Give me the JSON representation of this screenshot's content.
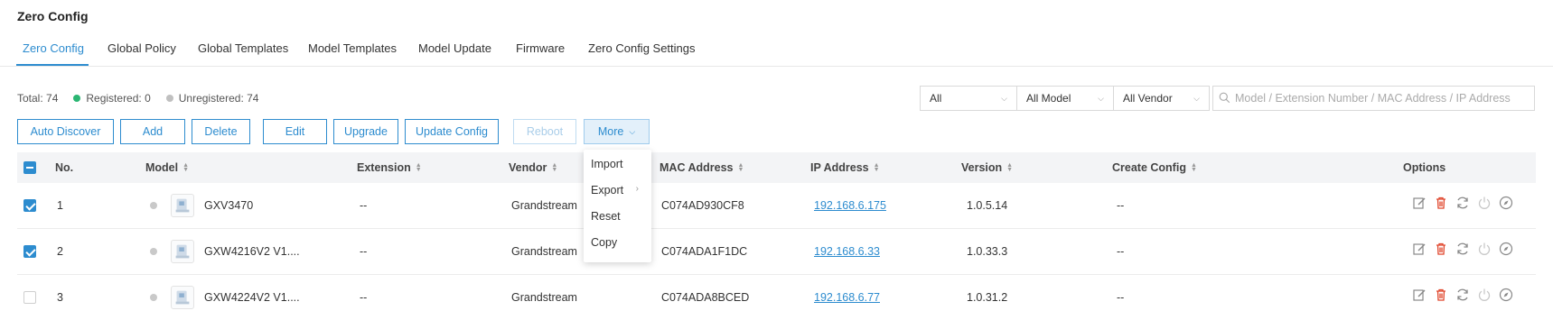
{
  "page": {
    "title": "Zero Config"
  },
  "tabs": [
    {
      "label": "Zero Config",
      "active": true
    },
    {
      "label": "Global Policy"
    },
    {
      "label": "Global Templates"
    },
    {
      "label": "Model Templates"
    },
    {
      "label": "Model Update"
    },
    {
      "label": "Firmware"
    },
    {
      "label": "Zero Config Settings"
    }
  ],
  "summary": {
    "total": "Total: 74",
    "registered": "Registered: 0",
    "unregistered": "Unregistered: 74",
    "registered_color": "#2bb673",
    "unregistered_color": "#c0c0c0"
  },
  "filters": {
    "status": "All",
    "model": "All Model",
    "vendor": "All Vendor",
    "search_placeholder": "Model / Extension Number / MAC Address / IP Address"
  },
  "toolbar": {
    "auto_discover": "Auto Discover",
    "add": "Add",
    "delete": "Delete",
    "edit": "Edit",
    "upgrade": "Upgrade",
    "update_config": "Update Config",
    "reboot": "Reboot",
    "more": "More"
  },
  "more_menu": {
    "items": [
      "Import",
      "Export",
      "Reset",
      "Copy"
    ]
  },
  "table": {
    "columns": {
      "no": "No.",
      "model": "Model",
      "extension": "Extension",
      "vendor": "Vendor",
      "mac": "MAC Address",
      "ip": "IP Address",
      "version": "Version",
      "create_config": "Create Config",
      "options": "Options"
    },
    "rows": [
      {
        "no": "1",
        "checked": true,
        "model": "GXV3470",
        "extension": "--",
        "vendor": "Grandstream",
        "mac": "C074AD930CF8",
        "ip": "192.168.6.175",
        "version": "1.0.5.14",
        "create_config": "--"
      },
      {
        "no": "2",
        "checked": true,
        "model": "GXW4216V2 V1....",
        "extension": "--",
        "vendor": "Grandstream",
        "mac": "C074ADA1F1DC",
        "ip": "192.168.6.33",
        "version": "1.0.33.3",
        "create_config": "--"
      },
      {
        "no": "3",
        "checked": false,
        "model": "GXW4224V2 V1....",
        "extension": "--",
        "vendor": "Grandstream",
        "mac": "C074ADA8BCED",
        "ip": "192.168.6.77",
        "version": "1.0.31.2",
        "create_config": "--"
      }
    ]
  },
  "colors": {
    "accent": "#2d8ccf",
    "delete": "#e0452b"
  }
}
